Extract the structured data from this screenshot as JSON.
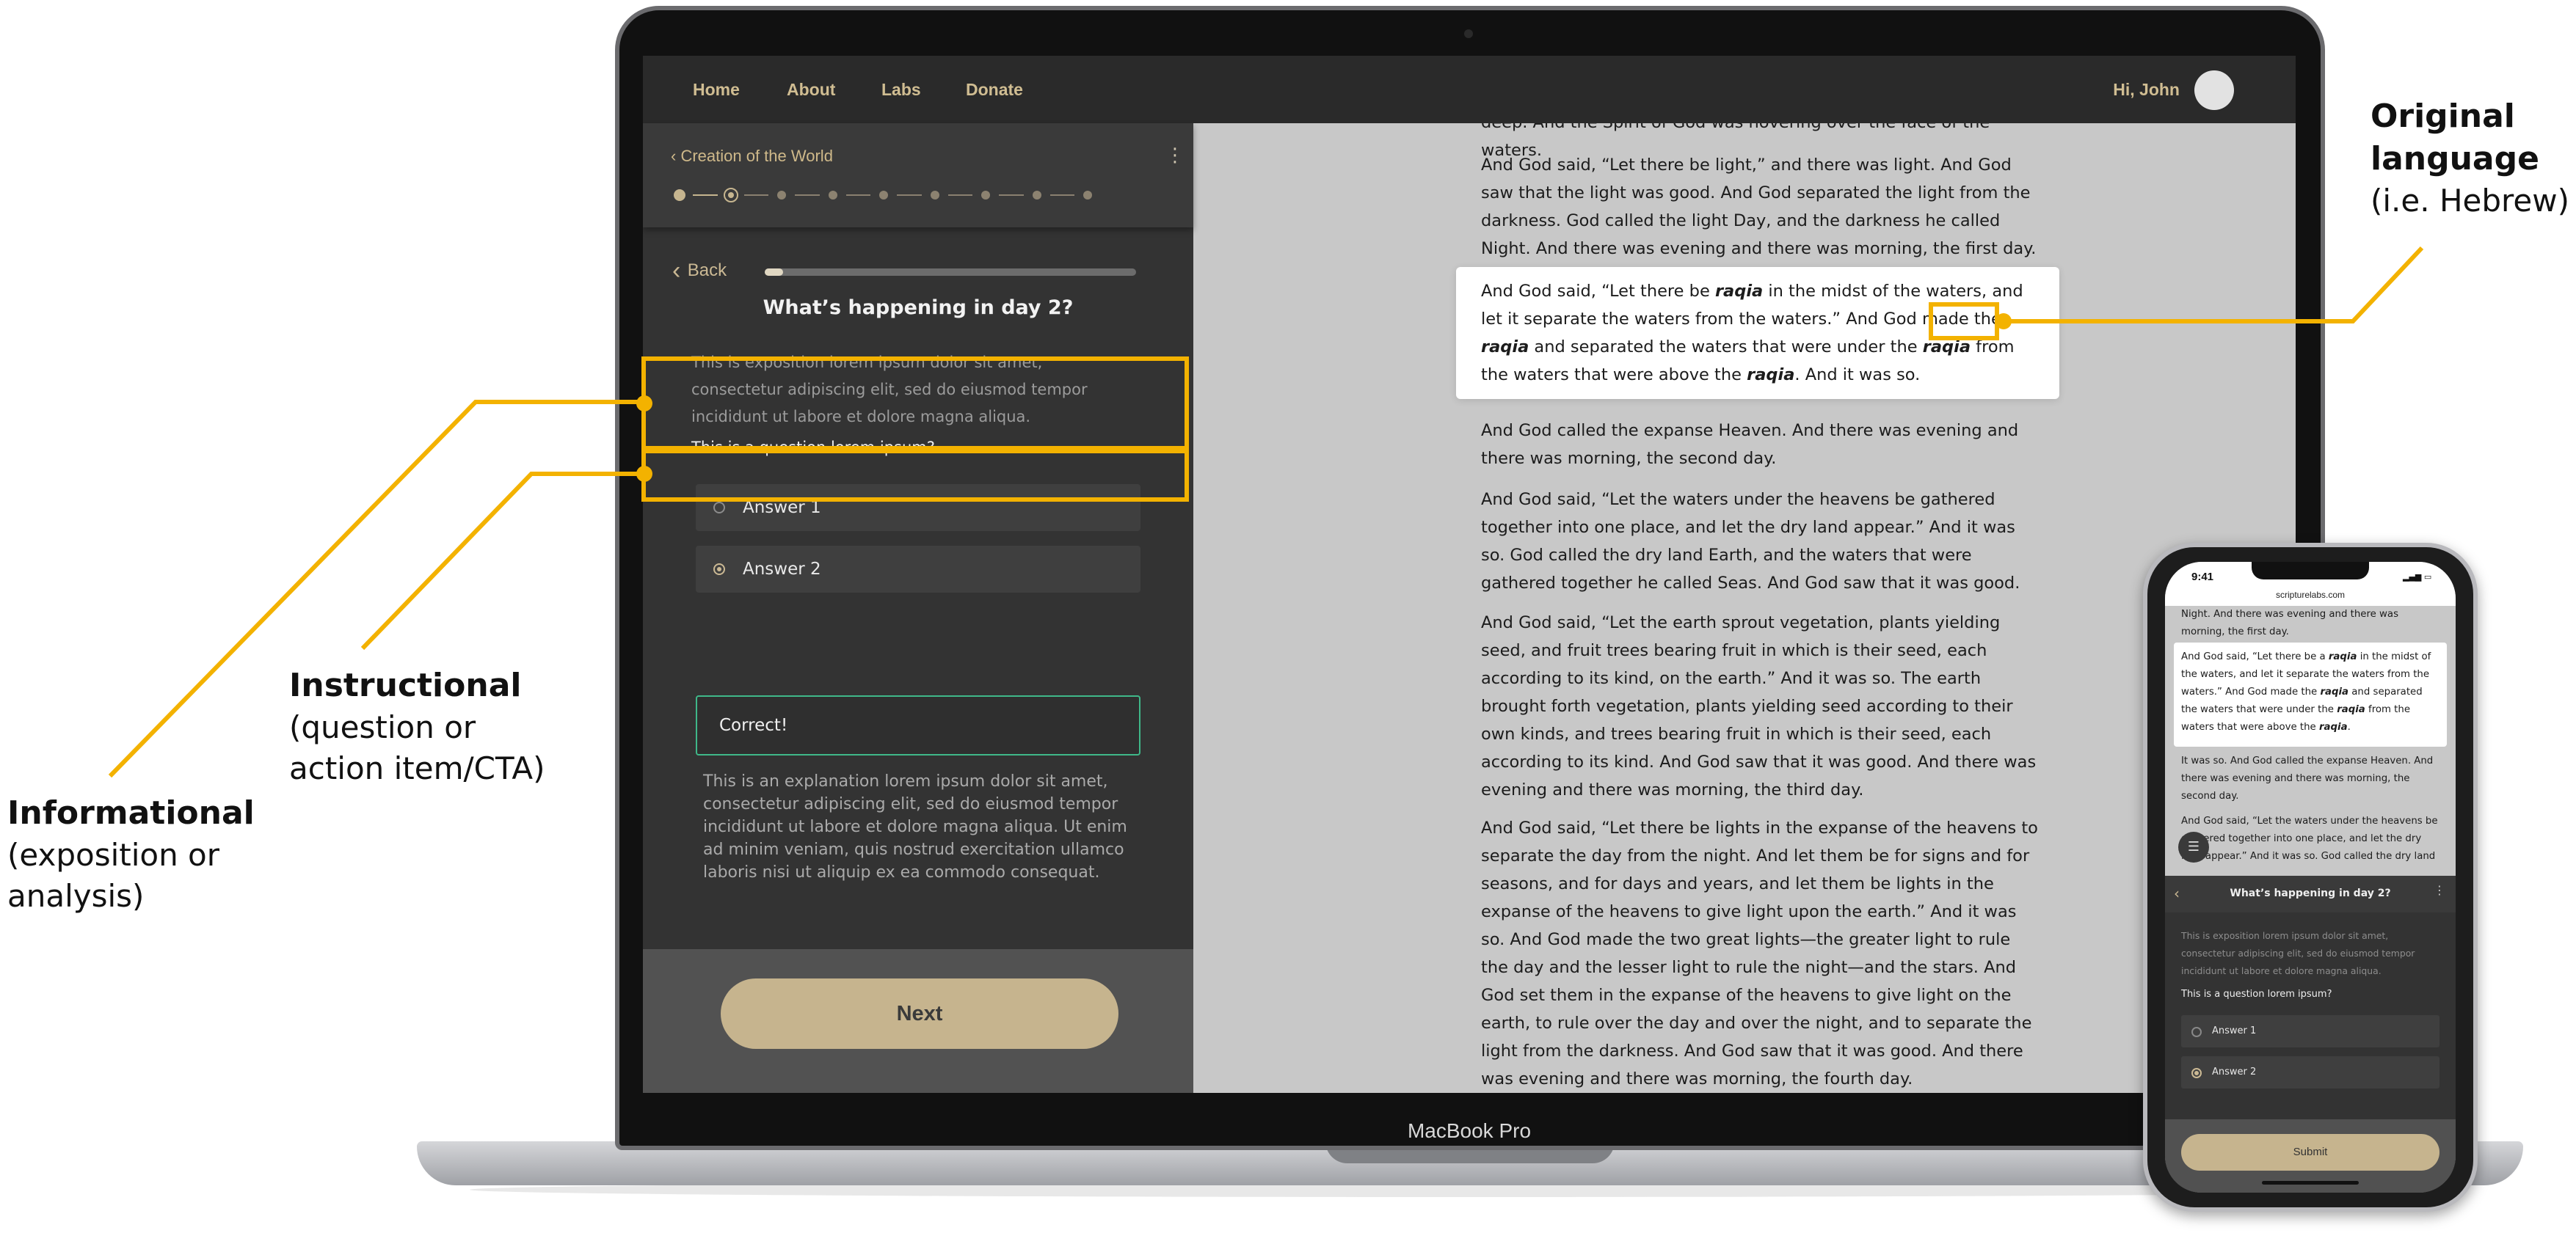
{
  "annotations": {
    "informational": {
      "title": "Informational",
      "sub": [
        "(exposition or",
        "analysis)"
      ]
    },
    "instructional": {
      "title": "Instructional",
      "sub": [
        "(question or",
        "action item/CTA)"
      ]
    },
    "original_language": {
      "title": [
        "Original",
        "language"
      ],
      "sub": "(i.e. Hebrew)"
    },
    "highlight_color": "#f3b200"
  },
  "laptop": {
    "label": "MacBook Pro"
  },
  "nav": {
    "items": [
      "Home",
      "About",
      "Labs",
      "Donate"
    ],
    "greeting": "Hi, John"
  },
  "lesson": {
    "breadcrumb": "Creation of the World",
    "steps_total": 9,
    "current_step": 2,
    "back_label": "Back",
    "progress": 0.05,
    "question_title": "What’s happening in day 2?",
    "exposition": "This is exposition lorem ipsum dolor sit amet, consectetur adipiscing elit, sed do eiusmod tempor incididunt ut labore et dolore magna aliqua.",
    "question": "This is a question lorem ipsum?",
    "answers": [
      {
        "label": "Answer 1",
        "selected": false
      },
      {
        "label": "Answer 2",
        "selected": true
      }
    ],
    "feedback": "Correct!",
    "explanation": "This is an explanation lorem ipsum dolor sit amet, consectetur adipiscing elit, sed do eiusmod tempor incididunt ut labore et dolore magna aliqua. Ut enim ad minim veniam, quis nostrud exercitation ullamco laboris nisi ut aliquip ex ea commodo consequat.",
    "next_label": "Next",
    "accent_color": "#c6b48e",
    "correct_color": "#3fb889"
  },
  "reader": {
    "top_partial": "deep. And the Spirit of God was hovering over the face of the waters.",
    "p1": "And God said, “Let there be light,” and there was light. And God saw that the light was good. And God separated the light from the darkness. God called the light Day, and the darkness he called Night. And there was evening and there was morning, the first day.",
    "highlighted": {
      "s1": "And God said, “Let there be ",
      "word": "raqia",
      "s2": " in the midst of the waters, and let it separate the waters from the waters.” And God made the ",
      "s3": " and separated the waters that were under the ",
      "s4": " from the waters that were above the ",
      "s5": ". And it was so."
    },
    "p3": "And God called the expanse Heaven. And there was evening and there was morning, the second day.",
    "p4": "And God said, “Let the waters under the heavens be gathered together into one place, and let the dry land appear.” And it was so. God called the dry land Earth, and the waters that were gathered together he called Seas. And God saw that it was good.",
    "p5": "And God said, “Let the earth sprout vegetation, plants yielding seed, and fruit trees bearing fruit in which is their seed, each according to its kind, on the earth.” And it was so. The earth brought forth vegetation, plants yielding seed according to their own kinds, and trees bearing fruit in which is their seed, each according to its kind. And God saw that it was good. And there was evening and there was morning, the third day.",
    "p6": "And God said, “Let there be lights in the expanse of the heavens to separate the day from the night. And let them be for signs and for seasons, and for days and years, and let them be lights in the expanse of the heavens to give light upon the earth.” And it was so. And God made the two great lights—the greater light to rule the day and the lesser light to rule the night—and the stars. And God set them in the expanse of the heavens to give light on the earth, to rule over the day and over the night, and to separate the light from the darkness. And God saw that it was good. And there was evening and there was morning, the fourth day."
  },
  "phone": {
    "time": "9:41",
    "url": "scripturelabs.com",
    "top_text": "Night. And there was evening and there was morning, the first day.",
    "card": {
      "s1": "And God said, “Let there be a ",
      "word": "raqia",
      "s2": " in the midst of the waters, and let it separate the waters from the waters.” And God made the ",
      "s3": " and separated the waters that were under the ",
      "s4": " from the waters that were above the ",
      "s5": "."
    },
    "after_card": "It was so. And God called the expanse Heaven. And there was evening and there was morning, the second day.",
    "p_next": "And God said, “Let the waters under the heavens be gathered together into one place, and let the dry land appear.” And it was so. God called the dry land",
    "sheet_title": "What’s happening in day 2?",
    "exposition": "This is exposition lorem ipsum dolor sit amet, consectetur adipiscing elit, sed do eiusmod tempor incididunt ut labore et dolore magna aliqua.",
    "question": "This is a question lorem ipsum?",
    "answers": [
      {
        "label": "Answer 1",
        "selected": false
      },
      {
        "label": "Answer 2",
        "selected": true
      }
    ],
    "submit_label": "Submit"
  }
}
